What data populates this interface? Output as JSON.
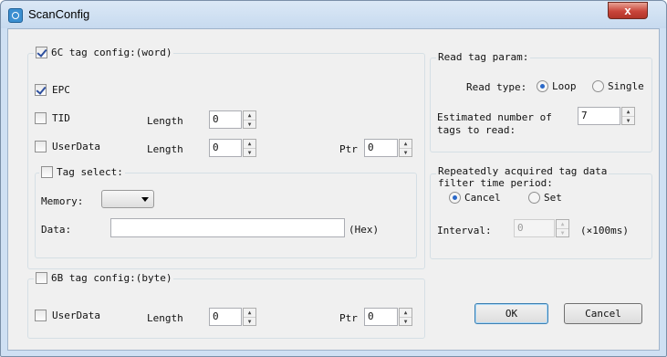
{
  "window": {
    "title": "ScanConfig",
    "close_glyph": "x"
  },
  "tag6c": {
    "group_label": "6C tag config:(word)",
    "group_checked": true,
    "epc": {
      "label": "EPC",
      "checked": true
    },
    "tid": {
      "label": "TID",
      "checked": false,
      "length_label": "Length",
      "length_value": "0"
    },
    "userdata": {
      "label": "UserData",
      "checked": false,
      "length_label": "Length",
      "length_value": "0",
      "ptr_label": "Ptr",
      "ptr_value": "0"
    },
    "tag_select": {
      "label": "Tag select:",
      "checked": false,
      "memory_label": "Memory:",
      "memory_value": "",
      "data_label": "Data:",
      "data_value": "",
      "hex_label": "(Hex)"
    }
  },
  "tag6b": {
    "group_label": "6B tag config:(byte)",
    "group_checked": false,
    "userdata": {
      "label": "UserData",
      "checked": false,
      "length_label": "Length",
      "length_value": "0",
      "ptr_label": "Ptr",
      "ptr_value": "0"
    }
  },
  "read_param": {
    "group_label": "Read tag param:",
    "read_type_label": "Read type:",
    "loop_label": "Loop",
    "single_label": "Single",
    "selected": "Loop",
    "estimated_label_1": "Estimated number of",
    "estimated_label_2": "tags to read:",
    "estimated_value": "7"
  },
  "filter": {
    "group_label_1": "Repeatedly acquired tag data",
    "group_label_2": "filter time period:",
    "cancel_label": "Cancel",
    "set_label": "Set",
    "selected": "Cancel",
    "interval_label": "Interval:",
    "interval_value": "0",
    "interval_unit": "(×100ms)"
  },
  "buttons": {
    "ok": "OK",
    "cancel": "Cancel"
  }
}
